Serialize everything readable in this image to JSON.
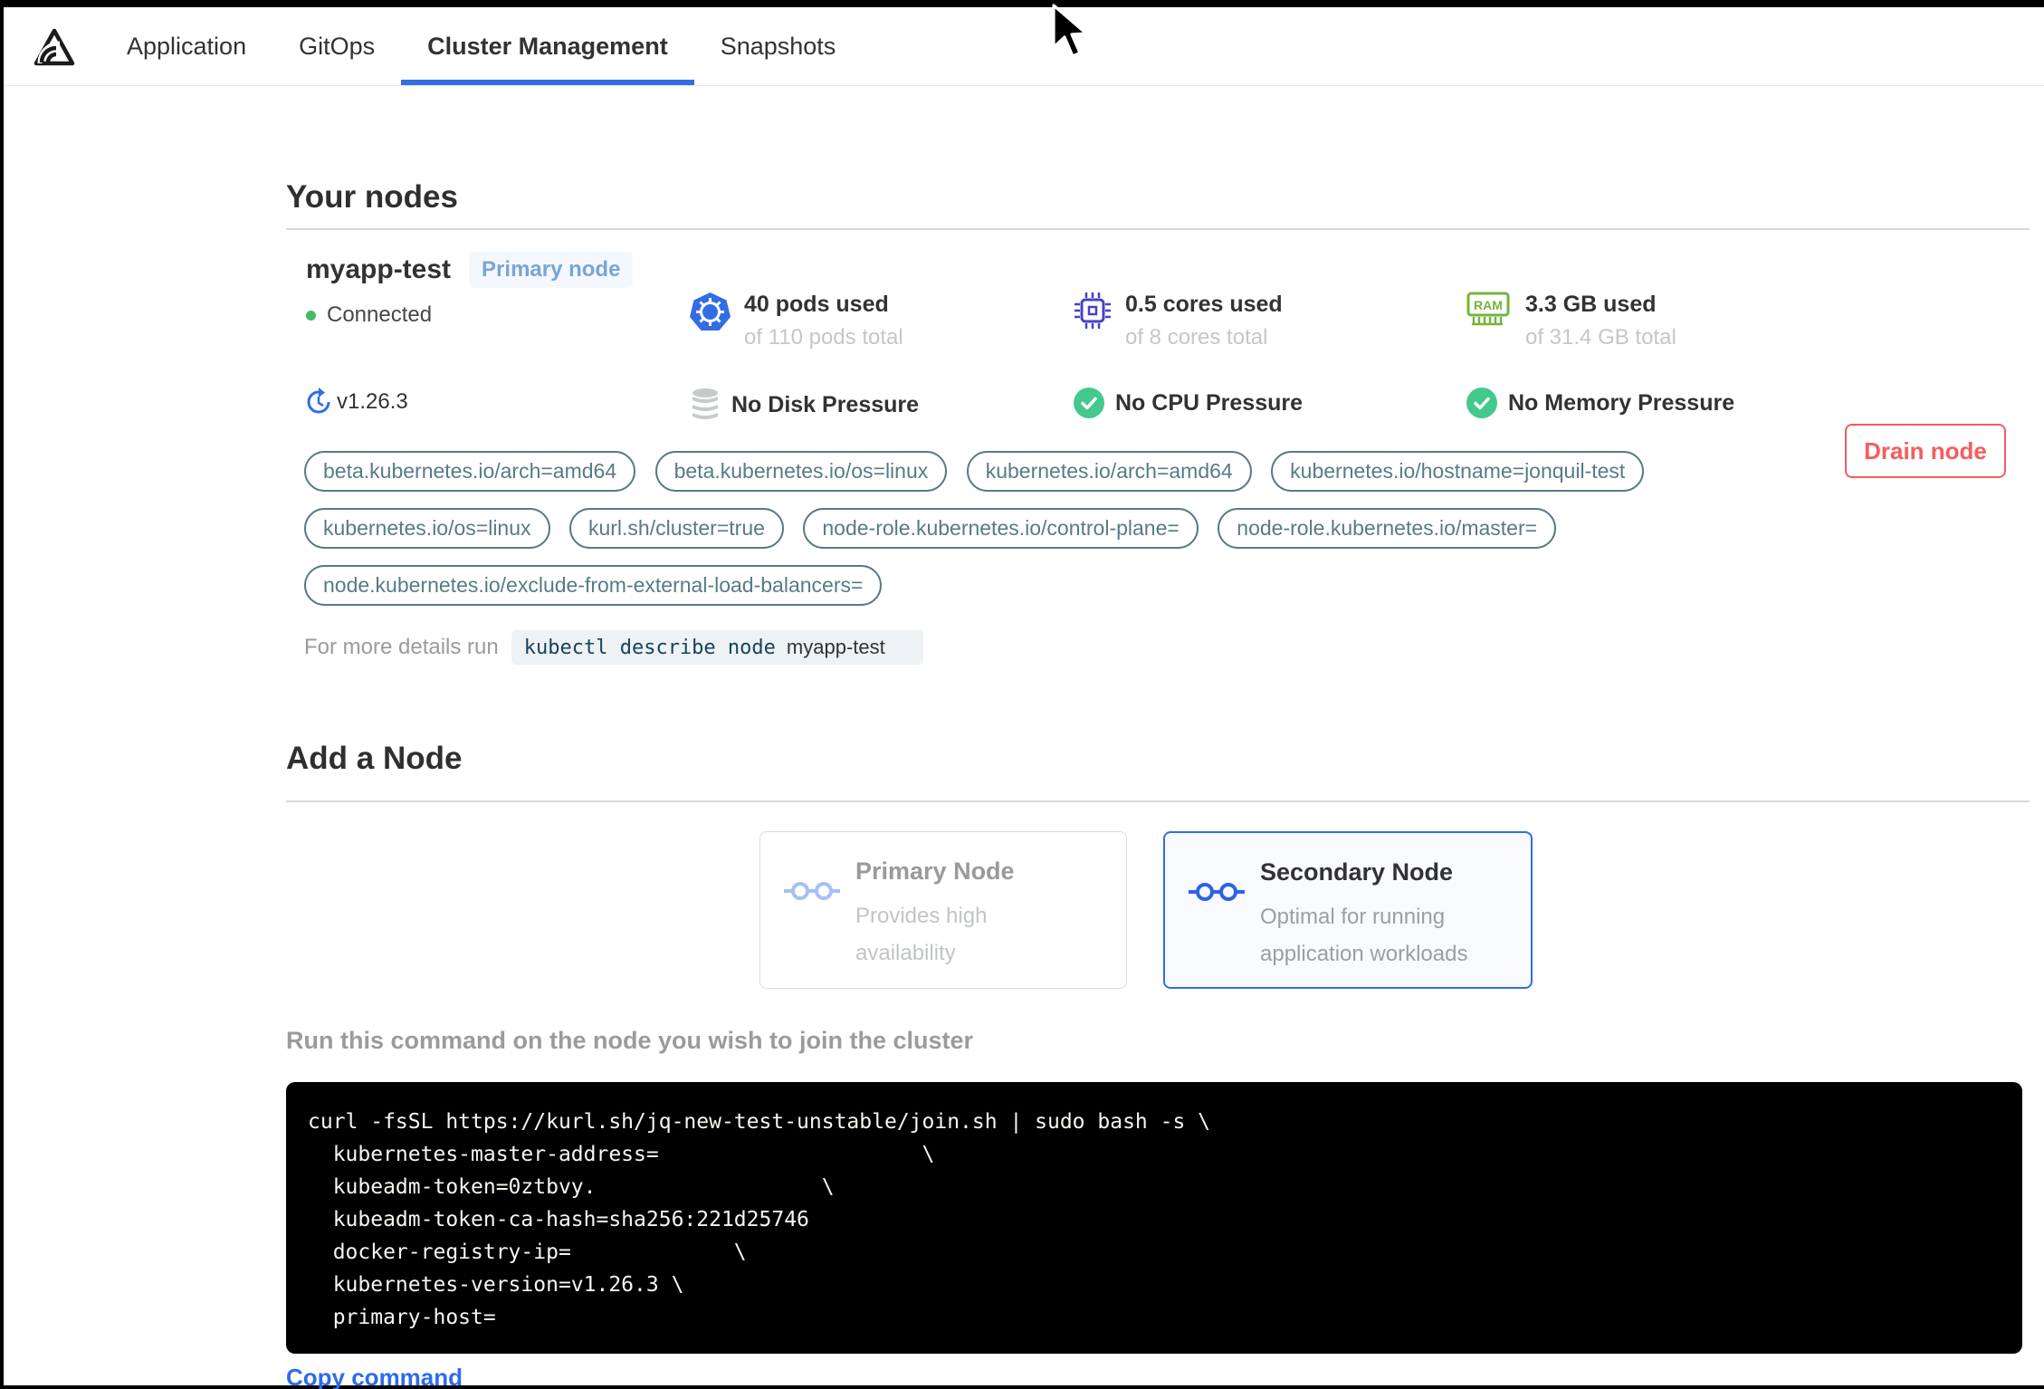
{
  "nav": {
    "tabs": [
      {
        "label": "Application"
      },
      {
        "label": "GitOps"
      },
      {
        "label": "Cluster Management"
      },
      {
        "label": "Snapshots"
      }
    ]
  },
  "your_nodes": {
    "title": "Your nodes",
    "node": {
      "name": "myapp-test",
      "badge": "Primary node",
      "status": "Connected",
      "version": "v1.26.3",
      "stats": [
        {
          "icon": "kubernetes-icon",
          "value": "40 pods used",
          "total": "of 110 pods total"
        },
        {
          "icon": "cpu-icon",
          "value": "0.5 cores used",
          "total": "of 8 cores total"
        },
        {
          "icon": "ram-icon",
          "value": "3.3 GB used",
          "total": "of 31.4 GB total"
        }
      ],
      "conditions": [
        {
          "icon": "disk-icon",
          "label": "No Disk Pressure"
        },
        {
          "icon": "check-icon",
          "label": "No CPU Pressure"
        },
        {
          "icon": "check-icon",
          "label": "No Memory Pressure"
        }
      ],
      "labels": [
        "beta.kubernetes.io/arch=amd64",
        "beta.kubernetes.io/os=linux",
        "kubernetes.io/arch=amd64",
        "kubernetes.io/hostname=jonquil-test",
        "kubernetes.io/os=linux",
        "kurl.sh/cluster=true",
        "node-role.kubernetes.io/control-plane=",
        "node-role.kubernetes.io/master=",
        "node.kubernetes.io/exclude-from-external-load-balancers="
      ],
      "details_hint": "For more details run",
      "details_command": "kubectl describe node",
      "details_node": "myapp-test",
      "drain_button": "Drain node"
    }
  },
  "add_node": {
    "title": "Add a Node",
    "options": [
      {
        "title": "Primary Node",
        "description": "Provides high availability"
      },
      {
        "title": "Secondary Node",
        "description": "Optimal for running application workloads"
      }
    ],
    "instruction": "Run this command on the node you wish to join the cluster",
    "command_lines": [
      "curl -fsSL https://kurl.sh/jq-new-test-unstable/join.sh | sudo bash -s \\",
      "  kubernetes-master-address=                     \\",
      "  kubeadm-token=0ztbvy.                  \\",
      "  kubeadm-token-ca-hash=sha256:221d25746",
      "  docker-registry-ip=             \\",
      "  kubernetes-version=v1.26.3 \\",
      "  primary-host="
    ],
    "copy_link": "Copy command"
  },
  "colors": {
    "accent_blue": "#326de6",
    "danger_red": "#f65c5c",
    "pill_teal": "#577b85",
    "success_green": "#44c88e",
    "connected_green": "#44bb66"
  }
}
